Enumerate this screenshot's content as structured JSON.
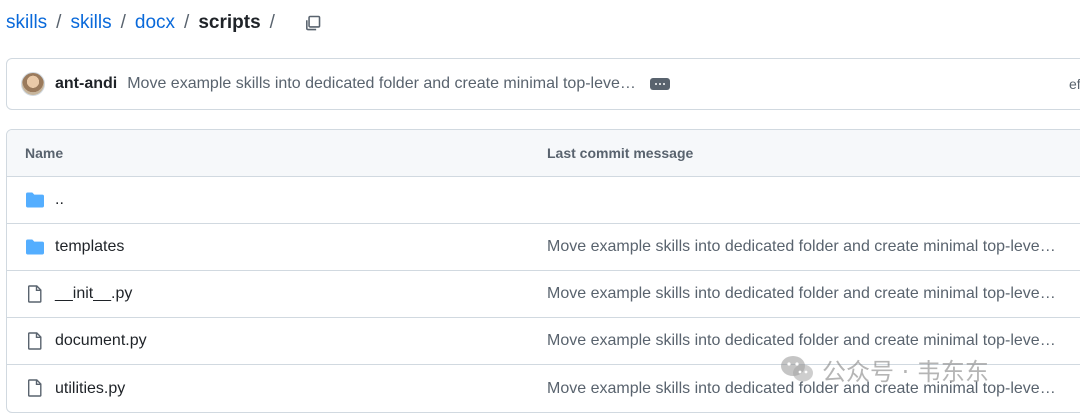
{
  "breadcrumb": {
    "items": [
      "skills",
      "skills",
      "docx"
    ],
    "current": "scripts",
    "separator": "/",
    "trailing_separator": "/"
  },
  "commit": {
    "author": "ant-andi",
    "message": "Move example skills into dedicated folder and create minimal top-leve…",
    "hash_partial": "ef"
  },
  "table": {
    "headers": {
      "name": "Name",
      "last_commit": "Last commit message"
    },
    "rows": [
      {
        "type": "parent",
        "icon": "folder-icon",
        "name": "..",
        "message": ""
      },
      {
        "type": "dir",
        "icon": "folder-icon",
        "name": "templates",
        "message": "Move example skills into dedicated folder and create minimal top-leve…"
      },
      {
        "type": "file",
        "icon": "file-icon",
        "name": "__init__.py",
        "message": "Move example skills into dedicated folder and create minimal top-leve…"
      },
      {
        "type": "file",
        "icon": "file-icon",
        "name": "document.py",
        "message": "Move example skills into dedicated folder and create minimal top-leve…"
      },
      {
        "type": "file",
        "icon": "file-icon",
        "name": "utilities.py",
        "message": "Move example skills into dedicated folder and create minimal top-leve…"
      }
    ]
  },
  "watermark": {
    "text": "公众号 · 韦东东"
  },
  "colors": {
    "link": "#0969da",
    "folder": "#54aeff",
    "muted": "#59636e",
    "border": "#d1d9e0",
    "header_bg": "#f6f8fa"
  }
}
